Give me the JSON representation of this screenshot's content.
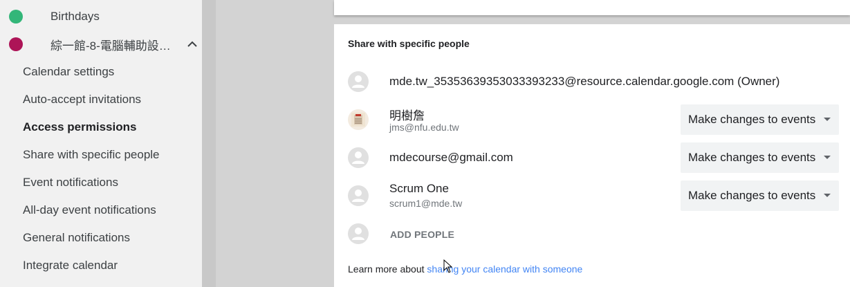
{
  "sidebar": {
    "calendars": [
      {
        "label": "Birthdays",
        "color": "#33b679"
      },
      {
        "label": "綜一館-8-電腦輔助設…",
        "color": "#ad1457"
      }
    ],
    "sub_items": [
      {
        "label": "Calendar settings",
        "active": false
      },
      {
        "label": "Auto-accept invitations",
        "active": false
      },
      {
        "label": "Access permissions",
        "active": true
      },
      {
        "label": "Share with specific people",
        "active": false
      },
      {
        "label": "Event notifications",
        "active": false
      },
      {
        "label": "All-day event notifications",
        "active": false
      },
      {
        "label": "General notifications",
        "active": false
      },
      {
        "label": "Integrate calendar",
        "active": false
      }
    ]
  },
  "share": {
    "title": "Share with specific people",
    "people": [
      {
        "name": "mde.tw_35353639353033393233@resource.calendar.google.com (Owner)",
        "email": "",
        "permission": ""
      },
      {
        "name": "明樹詹",
        "email": "jms@nfu.edu.tw",
        "permission": "Make changes to events"
      },
      {
        "name": "mdecourse@gmail.com",
        "email": "",
        "permission": "Make changes to events"
      },
      {
        "name": "Scrum One",
        "email": "scrum1@mde.tw",
        "permission": "Make changes to events"
      }
    ],
    "add_people": "ADD PEOPLE",
    "learn_prefix": "Learn more about ",
    "learn_link": "sharing your calendar with someone"
  }
}
